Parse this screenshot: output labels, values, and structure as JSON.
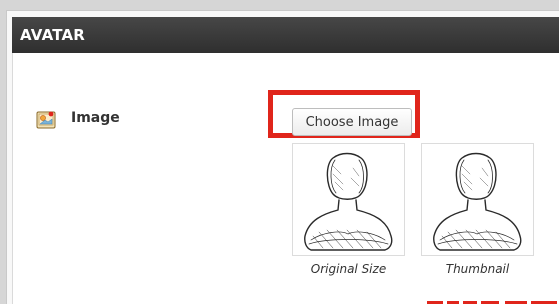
{
  "panel": {
    "title": "AVATAR"
  },
  "field": {
    "label": "Image",
    "icon": "image-icon"
  },
  "button": {
    "label": "Choose Image",
    "icon": "none"
  },
  "thumbnails": [
    {
      "caption": "Original Size",
      "icon": "avatar-silhouette-icon"
    },
    {
      "caption": "Thumbnail",
      "icon": "avatar-silhouette-icon"
    }
  ],
  "colors": {
    "header_bg": "#3a3a3a",
    "highlight": "#e0251b",
    "page_bg": "#ffffff"
  }
}
